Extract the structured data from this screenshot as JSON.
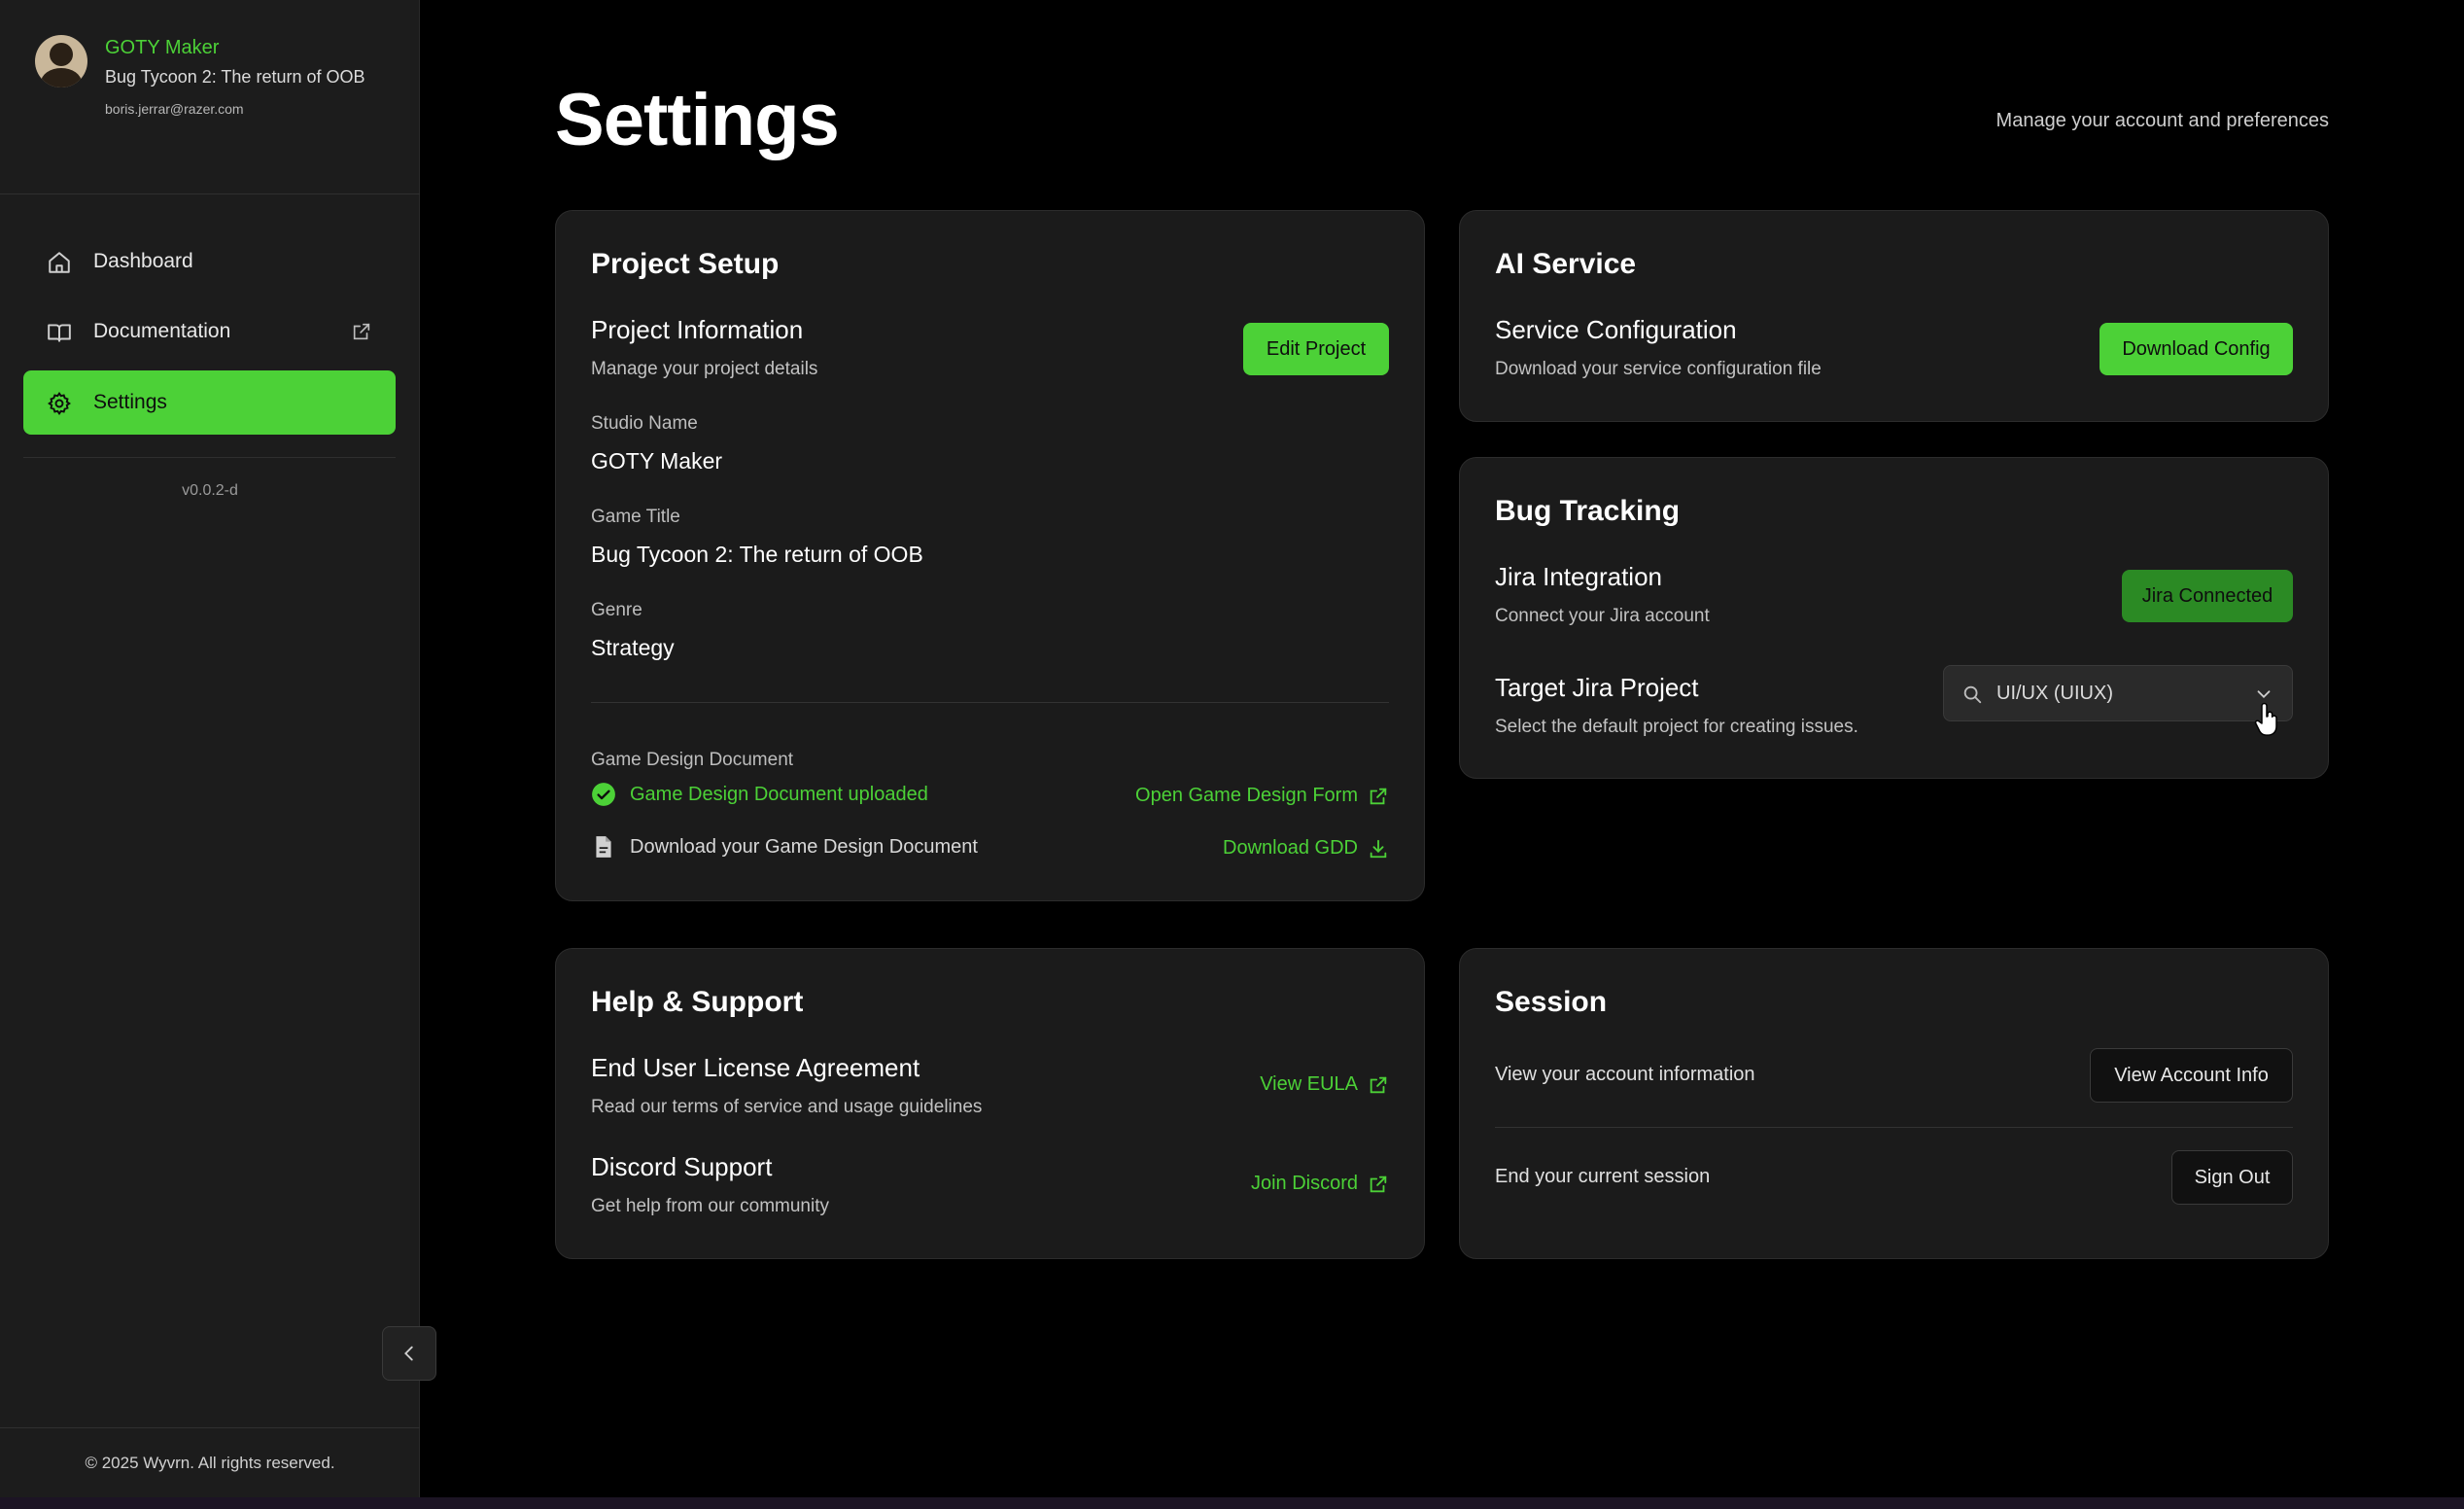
{
  "colors": {
    "accent": "#4cd137",
    "accent_dark": "#2b8a24",
    "background": "#000000",
    "card": "#1b1b1b",
    "sidebar": "#1c1c1c"
  },
  "profile": {
    "studio": "GOTY Maker",
    "game": "Bug Tycoon 2: The return of OOB",
    "email": "boris.jerrar@razer.com",
    "avatar_icon": "user-avatar"
  },
  "nav": {
    "items": [
      {
        "label": "Dashboard",
        "icon": "home-icon"
      },
      {
        "label": "Documentation",
        "icon": "book-icon"
      },
      {
        "label": "Settings",
        "icon": "gear-icon",
        "active": true
      }
    ]
  },
  "version": "v0.0.2-d",
  "footer": "© 2025 Wyvrn. All rights reserved.",
  "page": {
    "title": "Settings",
    "subtitle": "Manage your account and preferences"
  },
  "project_setup": {
    "title": "Project Setup",
    "info_title": "Project Information",
    "info_desc": "Manage your project details",
    "edit_button": "Edit Project",
    "fields": [
      {
        "label": "Studio Name",
        "value": "GOTY Maker"
      },
      {
        "label": "Game Title",
        "value": "Bug Tycoon 2: The return of OOB"
      },
      {
        "label": "Genre",
        "value": "Strategy"
      }
    ],
    "gdd_label": "Game Design Document",
    "gdd_uploaded": "Game Design Document uploaded",
    "gdd_form_link": "Open Game Design Form",
    "gdd_download_text": "Download your Game Design Document",
    "gdd_download_link": "Download GDD"
  },
  "ai_service": {
    "title": "AI Service",
    "config_title": "Service Configuration",
    "config_desc": "Download your service configuration file",
    "download_button": "Download Config"
  },
  "bug_tracking": {
    "title": "Bug Tracking",
    "jira_title": "Jira Integration",
    "jira_desc": "Connect your Jira account",
    "jira_button": "Jira Connected",
    "target_title": "Target Jira Project",
    "target_desc": "Select the default project for creating issues.",
    "target_value": "UI/UX (UIUX)"
  },
  "help": {
    "title": "Help & Support",
    "eula_title": "End User License Agreement",
    "eula_desc": "Read our terms of service and usage guidelines",
    "eula_link": "View EULA",
    "discord_title": "Discord Support",
    "discord_desc": "Get help from our community",
    "discord_link": "Join Discord"
  },
  "session": {
    "title": "Session",
    "account_text": "View your account information",
    "account_button": "View Account Info",
    "end_text": "End your current session",
    "signout_button": "Sign Out"
  }
}
